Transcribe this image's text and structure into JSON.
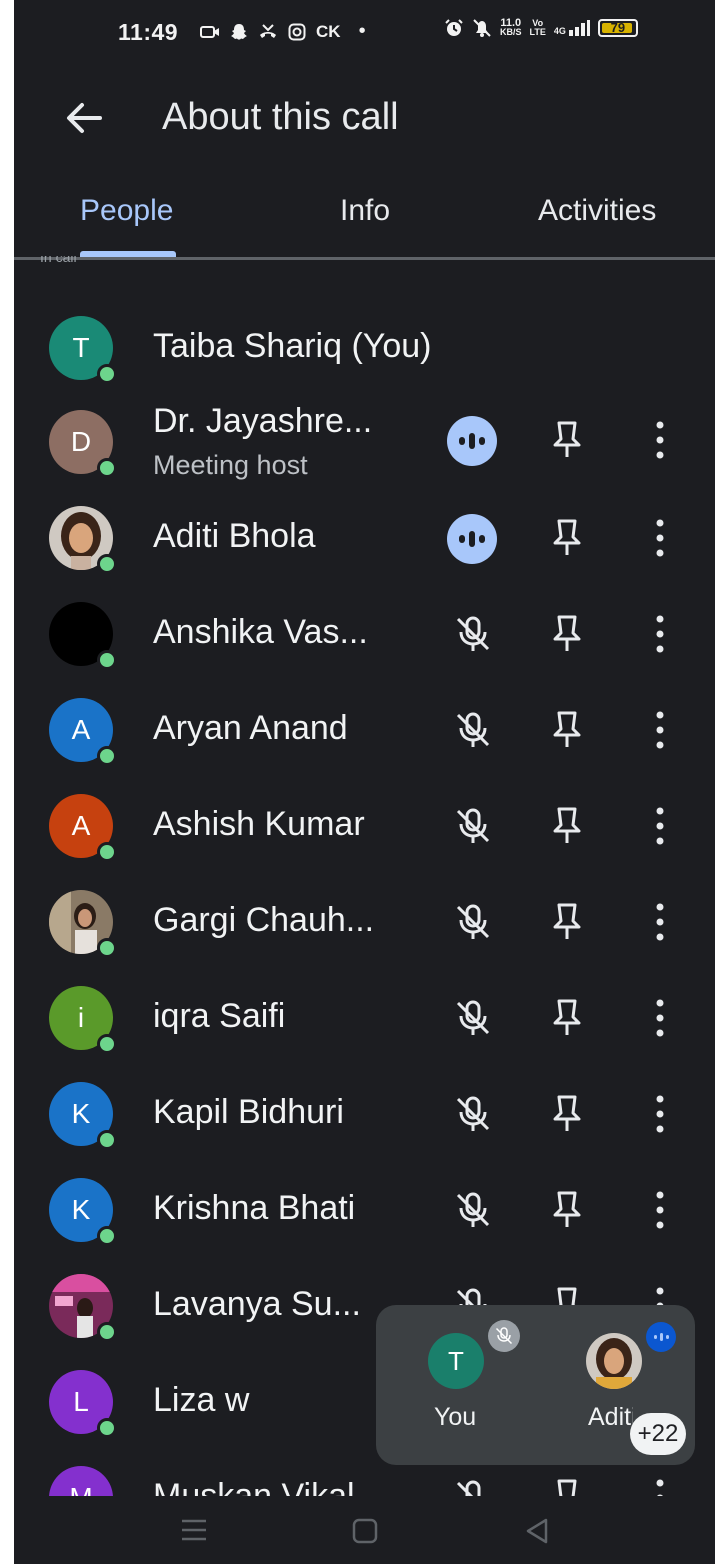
{
  "status_bar": {
    "time": "11:49",
    "left_icons": [
      "screen-record-icon",
      "snapchat-icon",
      "missed-call-icon",
      "instagram-icon",
      "ck-app-icon",
      "dot-icon"
    ],
    "ck_text": "CK",
    "speed_top": "11.0",
    "speed_bottom": "KB/S",
    "volte_top": "Vo",
    "volte_bottom": "LTE",
    "network": "4G",
    "battery": "79"
  },
  "appbar": {
    "title": "About this call"
  },
  "tabs": [
    {
      "label": "People",
      "active": true
    },
    {
      "label": "Info",
      "active": false
    },
    {
      "label": "Activities",
      "active": false
    }
  ],
  "section_header_clipped": "In call",
  "participants": [
    {
      "name": "Taiba Shariq (You)",
      "initial": "T",
      "color": "#1a8a76",
      "status": "none"
    },
    {
      "name": "Dr. Jayashre...",
      "subtitle": "Meeting host",
      "initial": "D",
      "color": "#8d6e63",
      "status": "talking"
    },
    {
      "name": "Aditi Bhola",
      "initial": "",
      "color": "photo",
      "status": "talking"
    },
    {
      "name": "Anshika Vas...",
      "initial": "",
      "color": "#000000",
      "status": "muted"
    },
    {
      "name": "Aryan Anand",
      "initial": "A",
      "color": "#1a73c8",
      "status": "muted"
    },
    {
      "name": "Ashish Kumar",
      "initial": "A",
      "color": "#c6410f",
      "status": "muted"
    },
    {
      "name": "Gargi Chauh...",
      "initial": "",
      "color": "photo",
      "status": "muted"
    },
    {
      "name": "iqra Saifi",
      "initial": "i",
      "color": "#5a9a2a",
      "status": "muted"
    },
    {
      "name": "Kapil Bidhuri",
      "initial": "K",
      "color": "#1a73c8",
      "status": "muted"
    },
    {
      "name": "Krishna Bhati",
      "initial": "K",
      "color": "#1a73c8",
      "status": "muted"
    },
    {
      "name": "Lavanya Su...",
      "initial": "",
      "color": "photo",
      "status": "muted"
    },
    {
      "name": "Liza w",
      "initial": "L",
      "color": "#8430ce",
      "status": "muted"
    },
    {
      "name": "Muskan Vikal",
      "initial": "M",
      "color": "#8430ce",
      "status": "muted"
    }
  ],
  "pip": {
    "self_initial": "T",
    "self_label": "You",
    "other_label": "Aditi",
    "more_count": "+22"
  },
  "colors": {
    "background": "#1c1d21",
    "accent": "#a8c7fa",
    "online": "#6dd58c",
    "pip_bg": "#3c4043"
  }
}
